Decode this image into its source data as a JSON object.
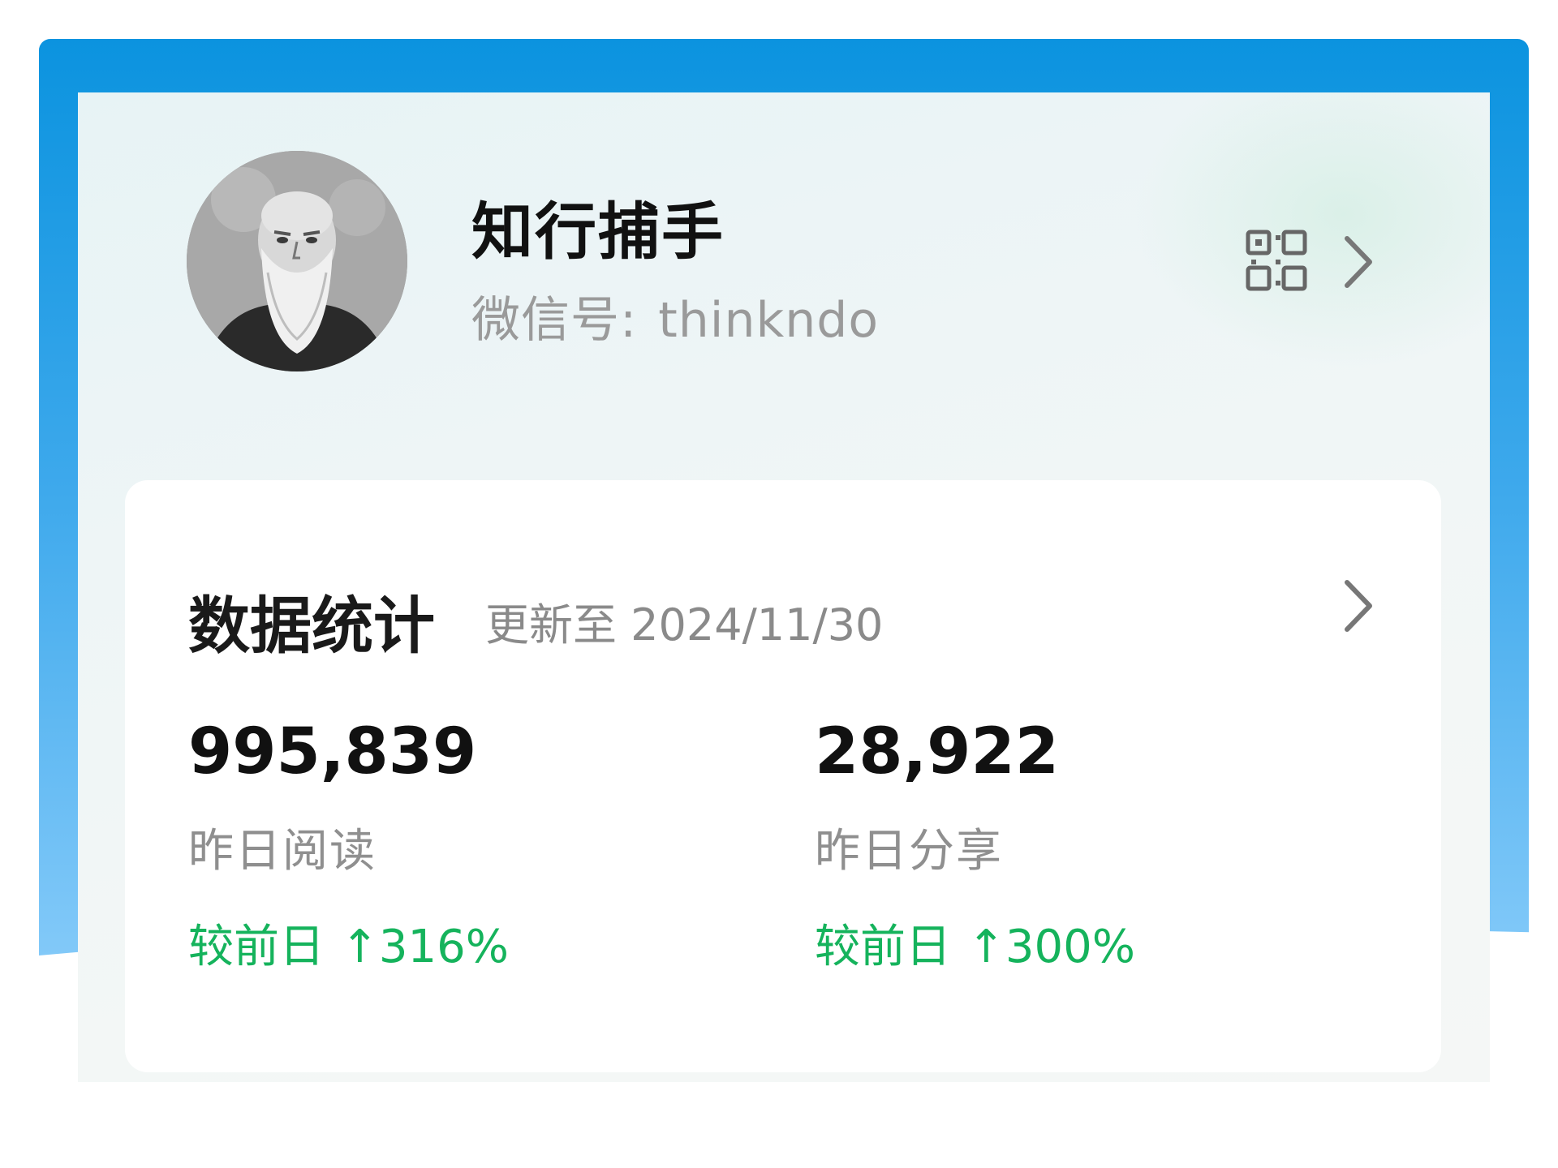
{
  "profile": {
    "name": "知行捕手",
    "wechat_label": "微信号:",
    "wechat_id": "thinkndo"
  },
  "stats": {
    "title": "数据统计",
    "updated": "更新至 2024/11/30",
    "items": [
      {
        "value": "995,839",
        "label": "昨日阅读",
        "change_prefix": "较前日",
        "change": "↑316%"
      },
      {
        "value": "28,922",
        "label": "昨日分享",
        "change_prefix": "较前日",
        "change": "↑300%"
      }
    ]
  },
  "colors": {
    "frame_blue": "#0b93df",
    "positive_green": "#15b35c"
  },
  "icons": [
    "qr-code-icon",
    "chevron-right-icon"
  ]
}
